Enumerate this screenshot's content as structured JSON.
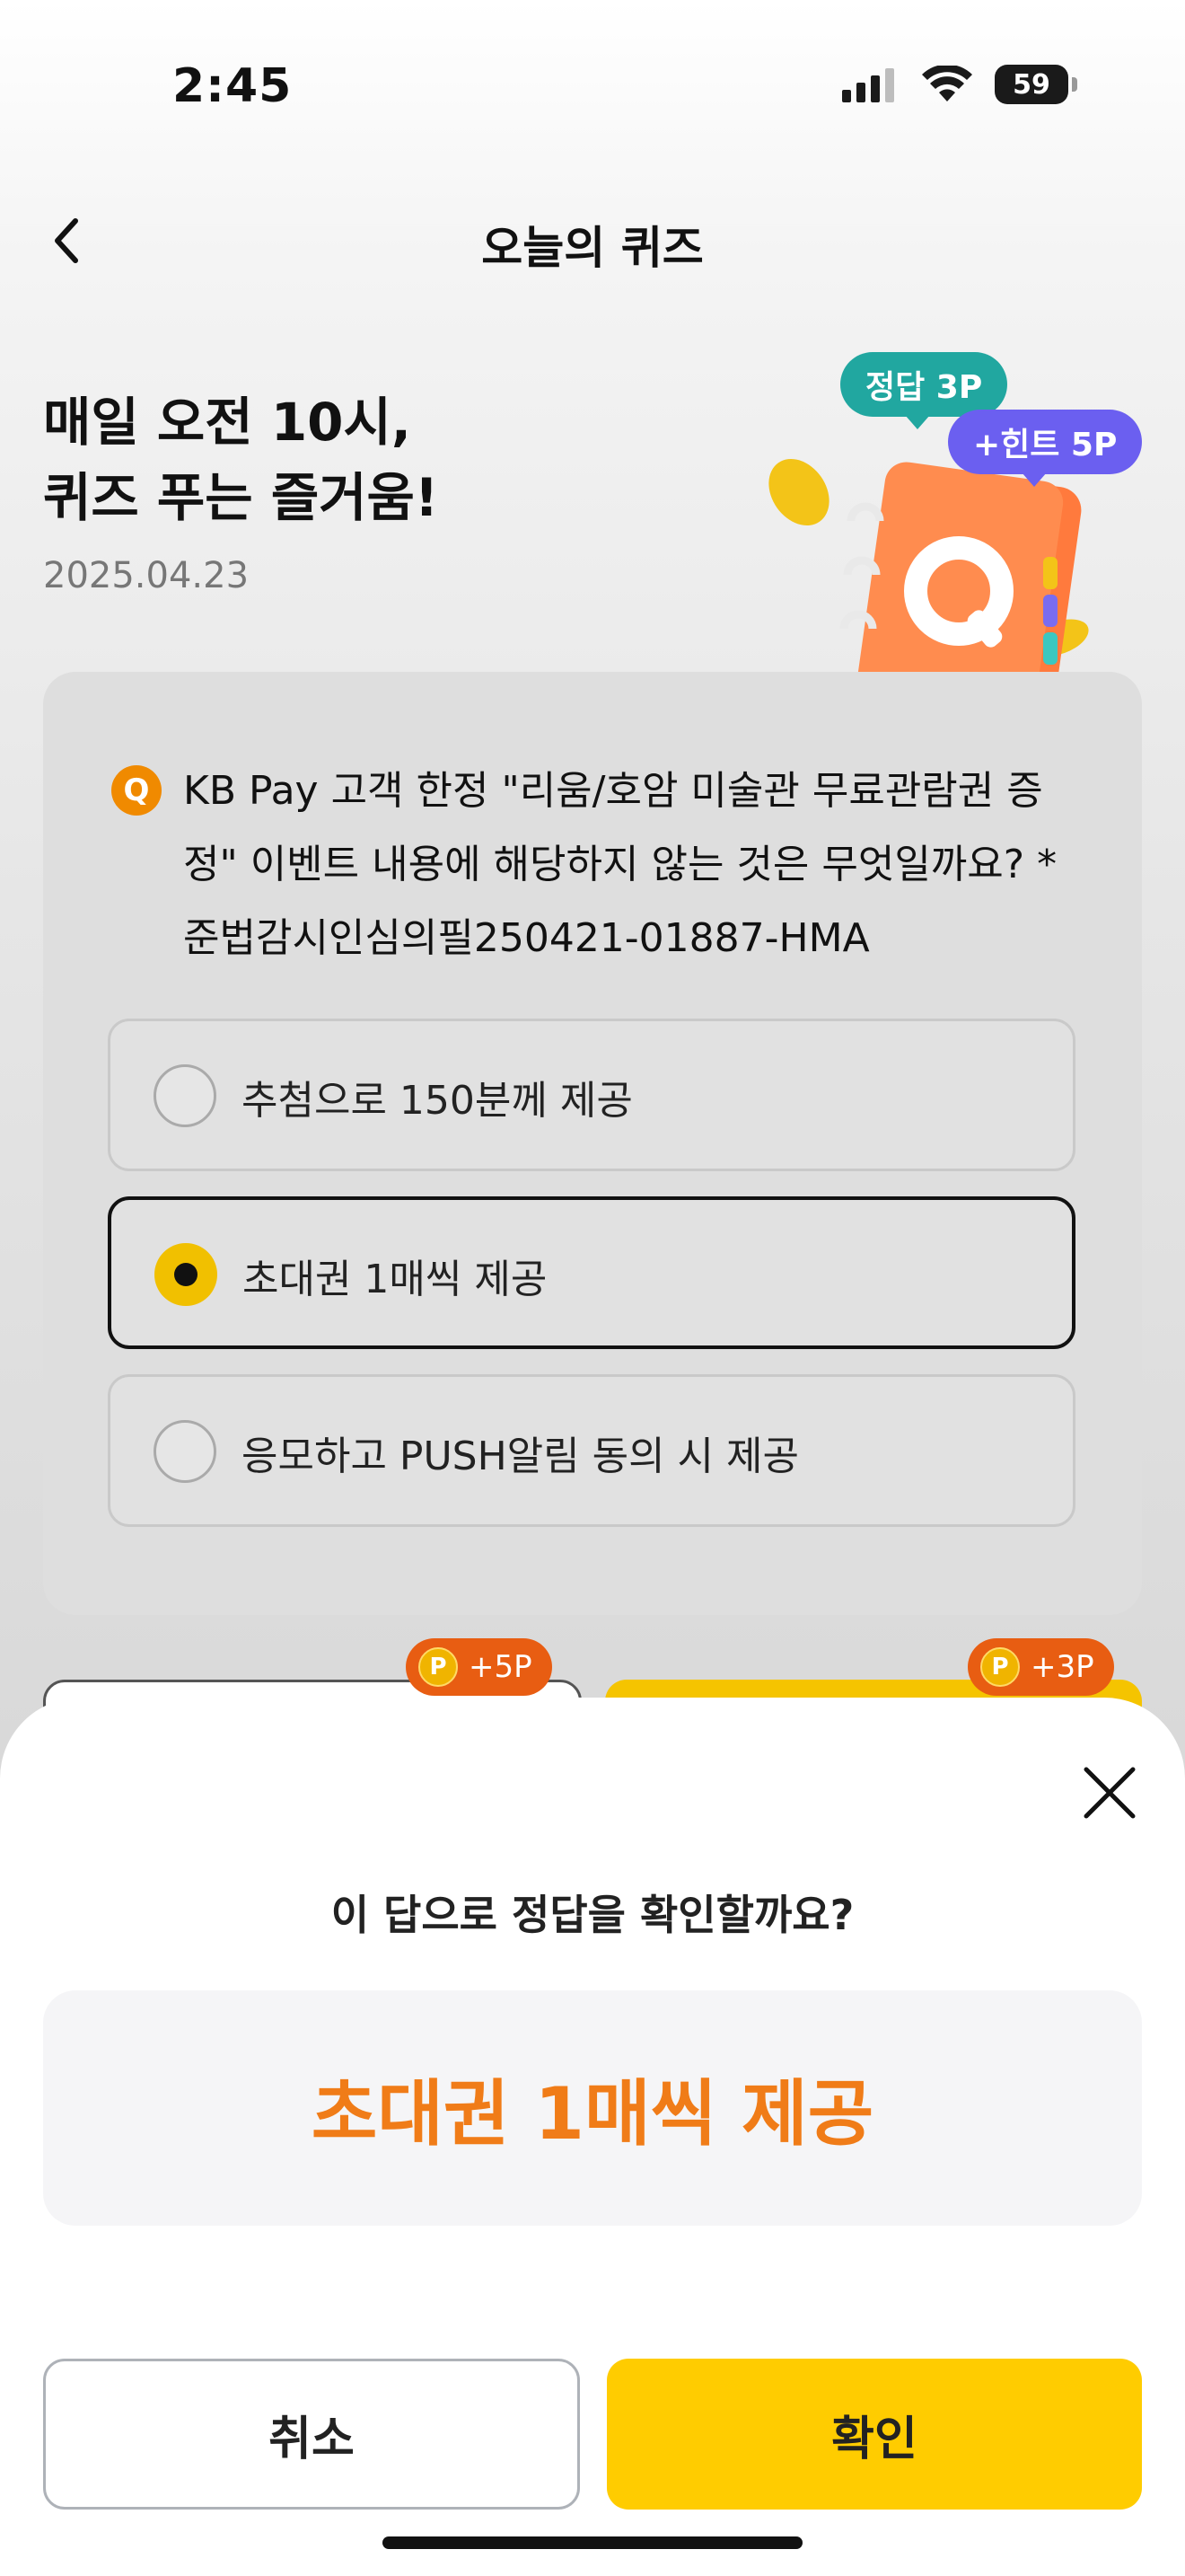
{
  "status_bar": {
    "time": "2:45",
    "battery": "59"
  },
  "nav": {
    "title": "오늘의 퀴즈"
  },
  "hero": {
    "title_line1": "매일 오전 10시,",
    "title_line2": "퀴즈 푸는 즐거움!",
    "date": "2025.04.23",
    "bubble_answer": "정답 3P",
    "bubble_hint": "+힌트 5P",
    "notebook_letter": "Q"
  },
  "quiz": {
    "badge": "Q",
    "question": "KB Pay 고객 한정 \"리움/호암 미술관 무료관람권 증정\" 이벤트 내용에 해당하지 않는 것은 무엇일까요? *준법감시인심의필250421-01887-HMA",
    "options": [
      {
        "label": "추첨으로 150분께 제공",
        "selected": false
      },
      {
        "label": "초대권 1매씩 제공",
        "selected": true
      },
      {
        "label": "응모하고 PUSH알림 동의 시 제공",
        "selected": false
      }
    ],
    "hint_points": "+5P",
    "answer_points": "+3P",
    "coin_letter": "P"
  },
  "sheet": {
    "question": "이 답으로 정답을 확인할까요?",
    "answer": "초대권 1매씩 제공",
    "cancel_label": "취소",
    "confirm_label": "확인"
  },
  "colors": {
    "accent_yellow": "#ffcc00",
    "answer_orange": "#f07c18",
    "bubble_teal": "#21a7a0",
    "bubble_purple": "#6b5ff0"
  }
}
